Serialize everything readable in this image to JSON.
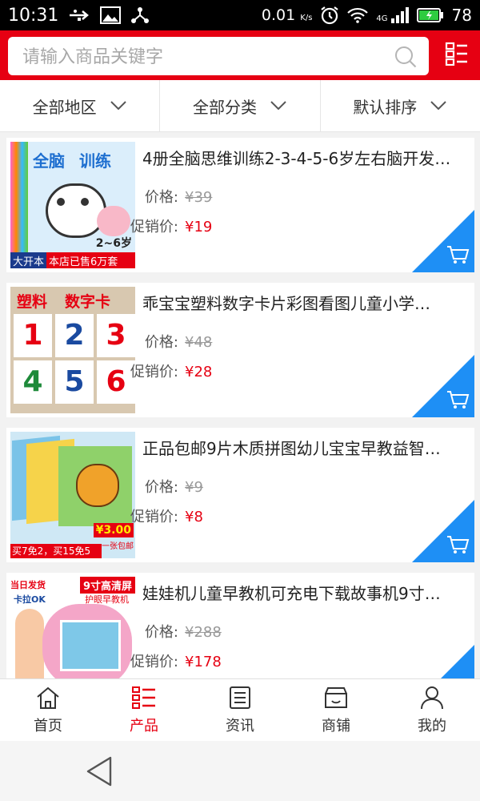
{
  "status_bar": {
    "time": "10:31",
    "network_speed": "0.01",
    "network_unit": "K/s",
    "signal": "4G",
    "battery": "78"
  },
  "search": {
    "placeholder": "请输入商品关键字",
    "value": ""
  },
  "filters": [
    {
      "label": "全部地区"
    },
    {
      "label": "全部分类"
    },
    {
      "label": "默认排序"
    }
  ],
  "labels": {
    "price": "价格:",
    "promo": "促销价:"
  },
  "products": [
    {
      "title": "4册全脑思维训练2-3-4-5-6岁左右脑开发…",
      "price": "¥39",
      "promo_price": "¥19",
      "image": {
        "headline": "全脑",
        "headline2": "训练",
        "age": "2~6岁",
        "banner_left": "大开本",
        "banner_right": "本店已售6万套"
      }
    },
    {
      "title": "乖宝宝塑料数字卡片彩图看图儿童小学…",
      "price": "¥48",
      "promo_price": "¥28",
      "image": {
        "tag_left": "塑料",
        "tag_right": "数字卡",
        "digits": [
          "1",
          "2",
          "3",
          "4",
          "5",
          "6"
        ]
      }
    },
    {
      "title": "正品包邮9片木质拼图幼儿宝宝早教益智…",
      "price": "¥9",
      "promo_price": "¥8",
      "image": {
        "price_tag": "¥3.00",
        "price_note": "一张包邮",
        "banner": "买7免2，买15免5"
      }
    },
    {
      "title": "娃娃机儿童早教机可充电下载故事机9寸…",
      "price": "¥288",
      "promo_price": "¥178",
      "image": {
        "top_left": "当日发货",
        "top_right": "9寸高清屏",
        "sub_left": "卡拉OK",
        "sub_right": "护眼早教机"
      }
    }
  ],
  "tabs": [
    {
      "label": "首页",
      "icon": "home-icon"
    },
    {
      "label": "产品",
      "icon": "product-list-icon"
    },
    {
      "label": "资讯",
      "icon": "news-icon"
    },
    {
      "label": "商铺",
      "icon": "shop-icon"
    },
    {
      "label": "我的",
      "icon": "user-icon"
    }
  ],
  "active_tab": "产品",
  "colors": {
    "brand_red": "#e60012",
    "cart_blue": "#1e8ff5"
  }
}
